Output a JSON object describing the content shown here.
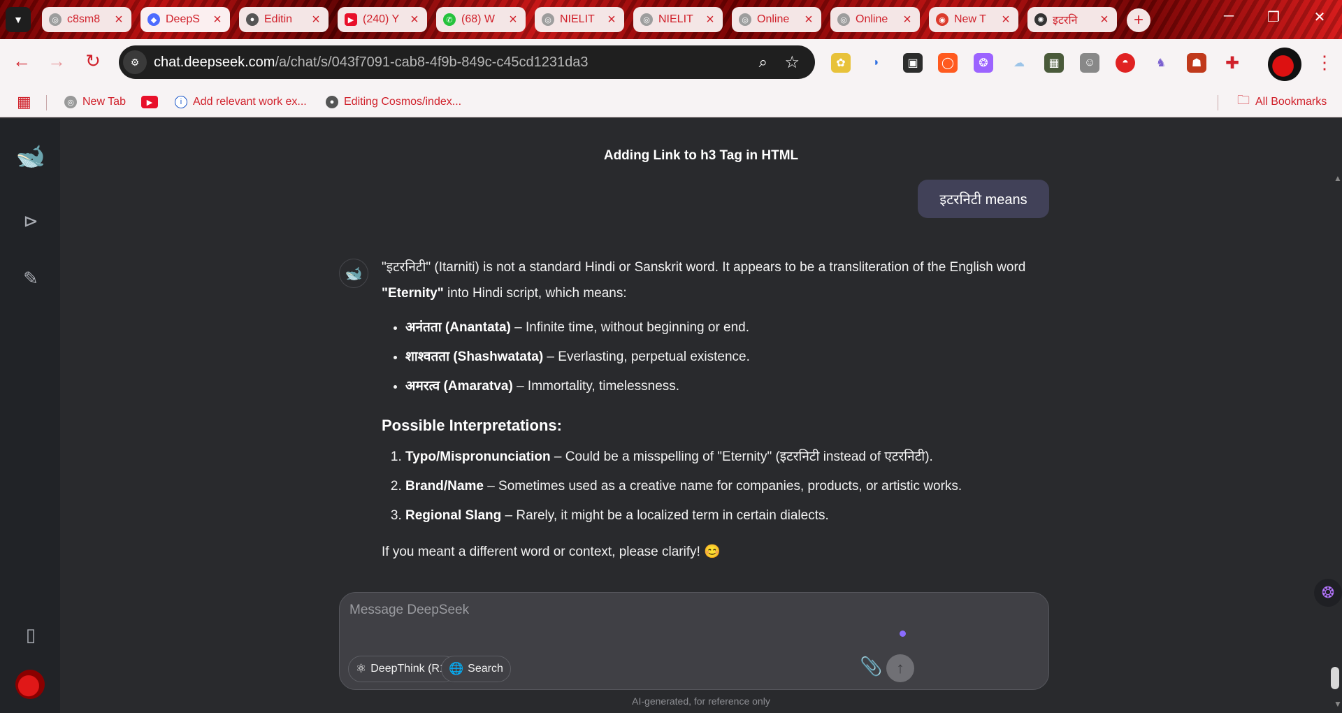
{
  "browser": {
    "tabs": [
      {
        "title": "c8sm8",
        "icon": "globe-icon"
      },
      {
        "title": "DeepS",
        "icon": "deepseek-icon"
      },
      {
        "title": "Editin",
        "icon": "github-icon"
      },
      {
        "title": "(240) Y",
        "icon": "youtube-icon"
      },
      {
        "title": "(68) W",
        "icon": "whatsapp-icon"
      },
      {
        "title": "NIELIT",
        "icon": "globe-icon"
      },
      {
        "title": "NIELIT",
        "icon": "globe-icon"
      },
      {
        "title": "Online",
        "icon": "globe-icon"
      },
      {
        "title": "Online",
        "icon": "globe-icon"
      },
      {
        "title": "New T",
        "icon": "chrome-icon"
      },
      {
        "title": "इटरनि",
        "icon": "openai-icon"
      }
    ],
    "url_domain": "chat.deepseek.com",
    "url_path": "/a/chat/s/043f7091-cab8-4f9b-849c-c45cd1231da3",
    "bookmarks": [
      {
        "label": "New Tab"
      },
      {
        "label": ""
      },
      {
        "label": "Add relevant work ex..."
      },
      {
        "label": "Editing Cosmos/index..."
      }
    ],
    "all_bookmarks": "All Bookmarks",
    "accent": "#d0202a"
  },
  "chat": {
    "title": "Adding Link to h3 Tag in HTML",
    "user_message": "इटरनिटी  means",
    "answer": {
      "intro_quote": "\"इटरनिटी\"",
      "intro_a": " (Itarniti) is not a standard Hindi or Sanskrit word. It appears to be a transliteration of the English word ",
      "intro_bold": "\"Eternity\"",
      "intro_b": " into Hindi script, which means:",
      "meanings": [
        {
          "term": "अनंतता (Anantata)",
          "desc": " – Infinite time, without beginning or end."
        },
        {
          "term": "शाश्वतता (Shashwatata)",
          "desc": " – Everlasting, perpetual existence."
        },
        {
          "term": "अमरत्व (Amaratva)",
          "desc": " – Immortality, timelessness."
        }
      ],
      "heading": "Possible Interpretations:",
      "interpretations": [
        {
          "term": "Typo/Mispronunciation",
          "desc": " – Could be a misspelling of \"Eternity\" (इटरनिटी instead of एटरनिटी)."
        },
        {
          "term": "Brand/Name",
          "desc": " – Sometimes used as a creative name for companies, products, or artistic works."
        },
        {
          "term": "Regional Slang",
          "desc": " – Rarely, it might be a localized term in certain dialects."
        }
      ],
      "closing": "If you meant a different word or context, please clarify! 😊"
    }
  },
  "composer": {
    "placeholder": "Message DeepSeek",
    "deepthink_label": "DeepThink (R1)",
    "search_label": "Search",
    "disclaimer": "AI-generated, for reference only"
  },
  "colors": {
    "background": "#292a2d",
    "sidebar": "#212327",
    "brand": "#4d6bfe"
  }
}
